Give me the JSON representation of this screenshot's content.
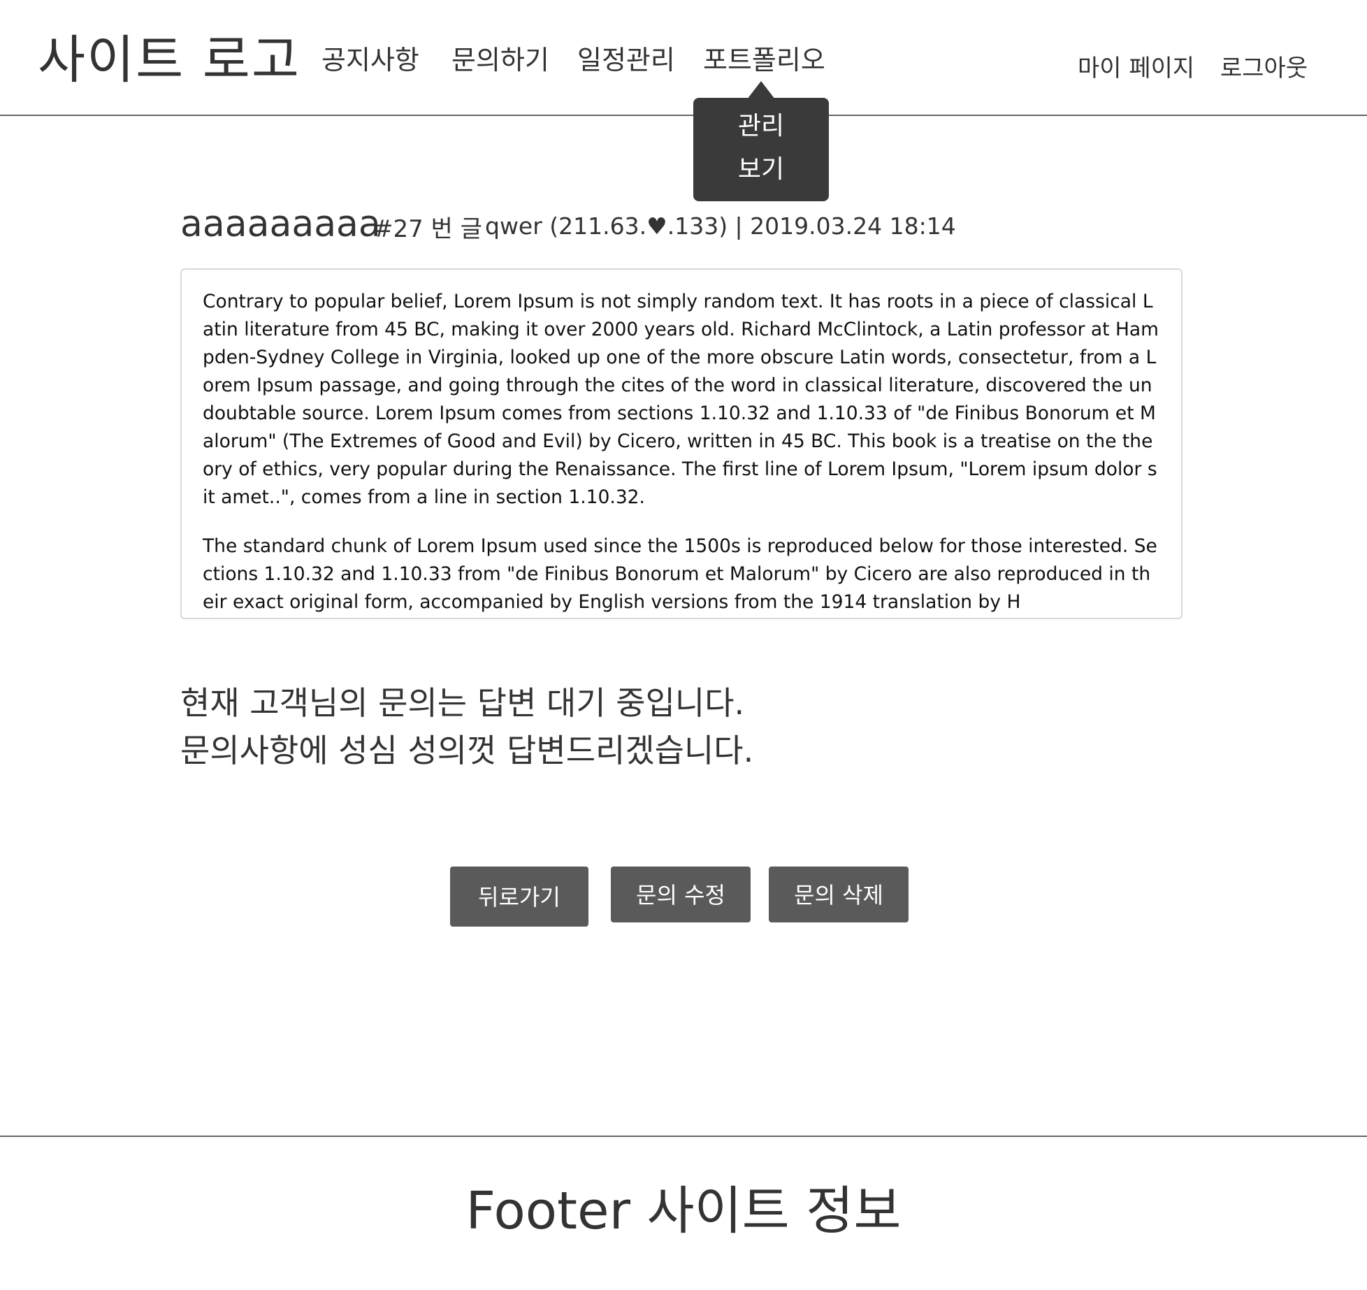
{
  "header": {
    "logo": "사이트 로고",
    "nav": [
      {
        "label": "공지사항"
      },
      {
        "label": "문의하기"
      },
      {
        "label": "일정관리"
      },
      {
        "label": "포트폴리오"
      }
    ],
    "dropdown": [
      {
        "label": "관리"
      },
      {
        "label": "보기"
      }
    ],
    "my_page": "마이 페이지",
    "logout": "로그아웃"
  },
  "post": {
    "title": "aaaaaaaaa",
    "number": "#27 번 글",
    "meta": "qwer (211.63.♥.133) | 2019.03.24 18:14",
    "paragraphs": [
      "Contrary to popular belief, Lorem Ipsum is not simply random text. It has roots in a piece of classical Latin literature from 45 BC, making it over 2000 years old. Richard McClintock, a Latin professor at Hampden-Sydney College in Virginia, looked up one of the more obscure Latin words, consectetur, from a Lorem Ipsum passage, and going through the cites of the word in classical literature, discovered the undoubtable source. Lorem Ipsum comes from sections 1.10.32 and 1.10.33 of \"de Finibus Bonorum et Malorum\" (The Extremes of Good and Evil) by Cicero, written in 45 BC. This book is a treatise on the theory of ethics, very popular during the Renaissance. The first line of Lorem Ipsum, \"Lorem ipsum dolor sit amet..\", comes from a line in section 1.10.32.",
      "The standard chunk of Lorem Ipsum used since the 1500s is reproduced below for those interested. Sections 1.10.32 and 1.10.33 from \"de Finibus Bonorum et Malorum\" by Cicero are also reproduced in their exact original form, accompanied by English versions from the 1914 translation by H"
    ]
  },
  "status": {
    "line1": "현재 고객님의 문의는 답변 대기 중입니다.",
    "line2": "문의사항에 성심 성의껏 답변드리겠습니다."
  },
  "buttons": {
    "back": "뒤로가기",
    "edit": "문의 수정",
    "delete": "문의 삭제"
  },
  "footer": {
    "text": "Footer 사이트 정보"
  }
}
